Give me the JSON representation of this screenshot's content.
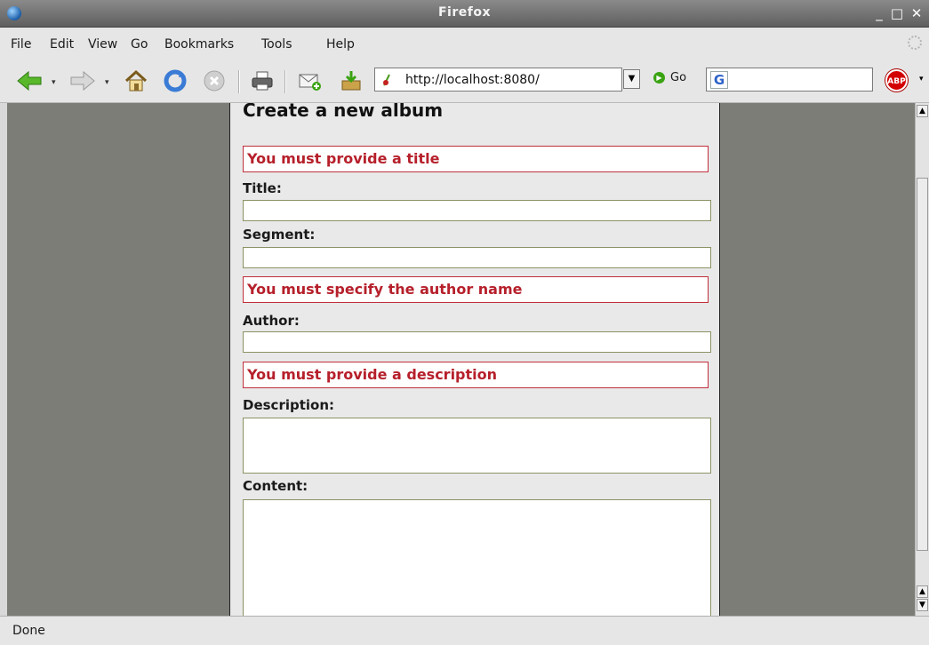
{
  "window": {
    "title": "Firefox",
    "btn_min": "_",
    "btn_max": "□",
    "btn_close": "✕"
  },
  "menu": {
    "file": "File",
    "edit": "Edit",
    "view": "View",
    "go": "Go",
    "bookmarks": "Bookmarks",
    "tools": "Tools",
    "help": "Help"
  },
  "toolbar": {
    "url": "http://localhost:8080/",
    "go_label": "Go",
    "search_engine_glyph": "G",
    "abp_label": "ABP"
  },
  "page": {
    "heading": "Create a new album",
    "error_title": "You must provide a title",
    "label_title": "Title:",
    "label_segment": "Segment:",
    "error_author": "You must specify the author name",
    "label_author": "Author:",
    "error_description": "You must provide a description",
    "label_description": "Description:",
    "label_content": "Content:",
    "field_values": {
      "title": "",
      "segment": "",
      "author": "",
      "description": "",
      "content": ""
    }
  },
  "status": {
    "text": "Done"
  },
  "icons": {
    "back": "back-arrow-icon",
    "forward": "forward-arrow-icon",
    "home": "home-icon",
    "reload": "reload-icon",
    "stop": "stop-icon",
    "print": "print-icon",
    "new_mail": "new-message-icon",
    "download": "download-icon"
  },
  "colors": {
    "error_text": "#b6202b",
    "error_border": "#c0303c",
    "field_border": "#8b9264",
    "page_bg": "#7c7d76"
  }
}
